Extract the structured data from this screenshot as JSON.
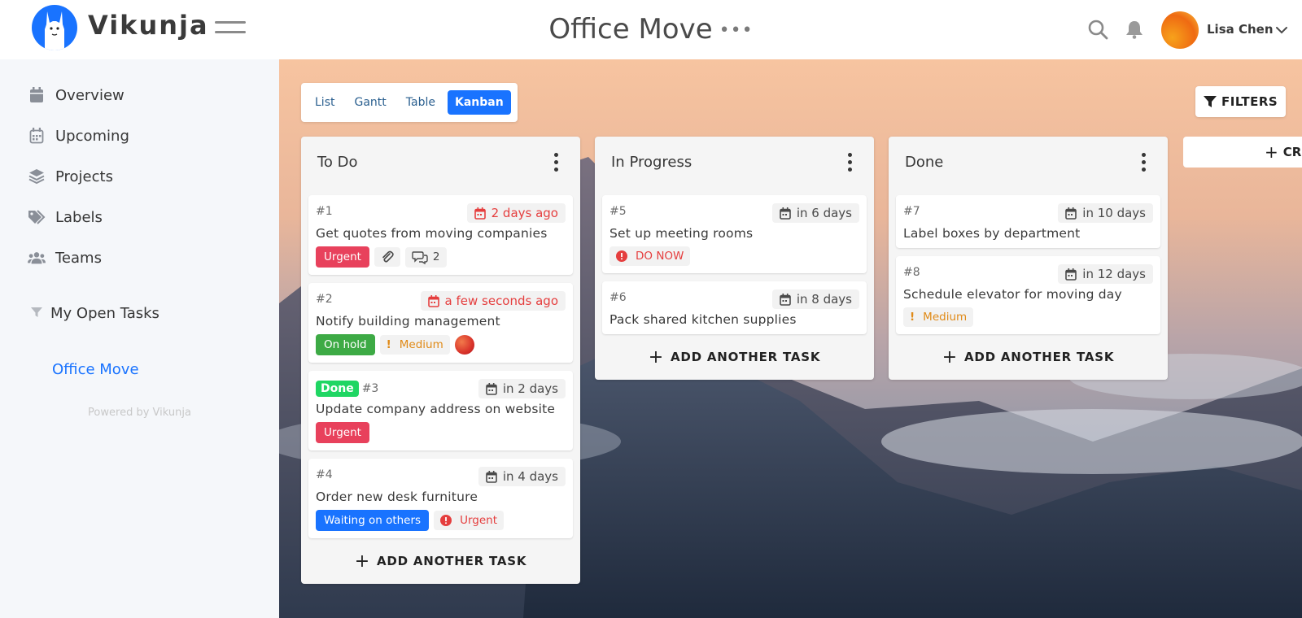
{
  "app": {
    "brand": "Vikunja"
  },
  "header": {
    "project_title": "Office Move",
    "user_name": "Lisa Chen"
  },
  "sidebar": {
    "items": [
      {
        "label": "Overview",
        "icon": "calendar-icon"
      },
      {
        "label": "Upcoming",
        "icon": "calendar-grid-icon"
      },
      {
        "label": "Projects",
        "icon": "layers-icon"
      },
      {
        "label": "Labels",
        "icon": "tags-icon"
      },
      {
        "label": "Teams",
        "icon": "users-icon"
      }
    ],
    "saved_filter": "My Open Tasks",
    "project": "Office Move",
    "powered_by": "Powered by Vikunja"
  },
  "views": {
    "list": "List",
    "gantt": "Gantt",
    "table": "Table",
    "kanban": "Kanban",
    "active": "Kanban"
  },
  "filters_label": "FILTERS",
  "create_bucket_label": "CRE",
  "add_task_label": "ADD ANOTHER TASK",
  "colors": {
    "accent": "#1973ff",
    "urgent": "#e8415c",
    "on_hold": "#3daa45",
    "waiting": "#1973ff",
    "done": "#1fd663",
    "overdue": "#e53e3e",
    "medium": "#e08a17"
  },
  "buckets": [
    {
      "title": "To Do",
      "tasks": [
        {
          "id": "#1",
          "due": "2 days ago",
          "title": "Get quotes from moving companies",
          "label": "Urgent",
          "attachments": true,
          "comments": "2"
        },
        {
          "id": "#2",
          "due": "a few seconds ago",
          "title": "Notify building management",
          "label": "On hold",
          "priority": "Medium",
          "assignee": true
        },
        {
          "id": "#3",
          "done": "Done",
          "due": "in 2 days",
          "title": "Update company address on website",
          "label": "Urgent"
        },
        {
          "id": "#4",
          "due": "in 4 days",
          "title": "Order new desk furniture",
          "label": "Waiting on others",
          "priority": "Urgent"
        }
      ]
    },
    {
      "title": "In Progress",
      "tasks": [
        {
          "id": "#5",
          "due": "in 6 days",
          "title": "Set up meeting rooms",
          "priority": "DO NOW"
        },
        {
          "id": "#6",
          "due": "in 8 days",
          "title": "Pack shared kitchen supplies"
        }
      ]
    },
    {
      "title": "Done",
      "tasks": [
        {
          "id": "#7",
          "due": "in 10 days",
          "title": "Label boxes by department"
        },
        {
          "id": "#8",
          "due": "in 12 days",
          "title": "Schedule elevator for moving day",
          "priority": "Medium"
        }
      ]
    }
  ]
}
